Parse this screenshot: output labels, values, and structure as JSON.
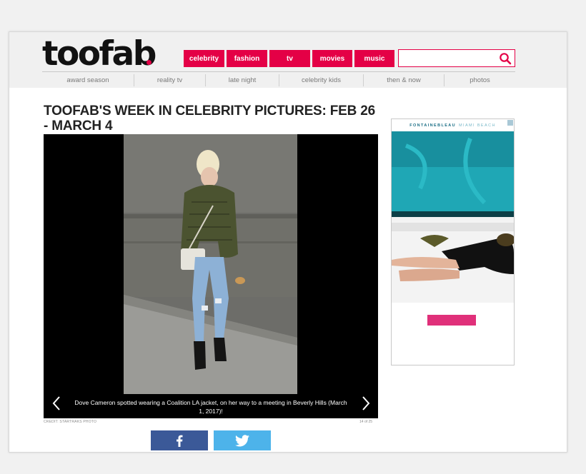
{
  "site": {
    "logo": "toofab"
  },
  "nav": [
    "celebrity",
    "fashion",
    "tv",
    "movies",
    "music"
  ],
  "search": {
    "placeholder": ""
  },
  "subnav": [
    "award season",
    "reality tv",
    "late night",
    "celebrity kids",
    "then & now",
    "photos"
  ],
  "article": {
    "title": "TOOFAB'S WEEK IN CELEBRITY PICTURES: FEB 26 - MARCH 4"
  },
  "gallery": {
    "caption": "Dove Cameron spotted wearing a Coalition LA jacket, on her way to a meeting in Beverly Hills (March 1, 2017)!",
    "credit": "CREDIT: STARTRAKS PHOTO",
    "counter": "14 of 25"
  },
  "share": {
    "facebook_icon": "facebook-icon",
    "twitter_icon": "twitter-icon"
  },
  "ad": {
    "brand_bold": "FONTAINEBLEAU",
    "brand_light": "MIAMI BEACH"
  },
  "colors": {
    "accent": "#e40046",
    "facebook": "#3b5998",
    "twitter": "#4db3ea",
    "ad_pink": "#e0307a"
  }
}
